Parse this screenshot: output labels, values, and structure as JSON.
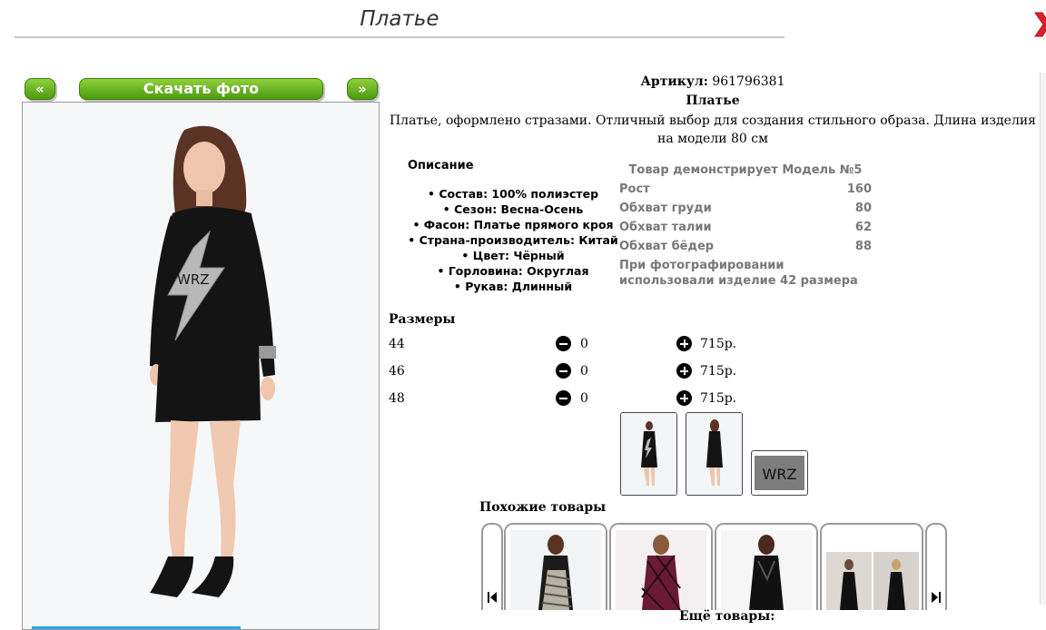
{
  "page_title": "Платье",
  "nav": {
    "prev": "«",
    "download": "Скачать фото",
    "next": "»"
  },
  "product": {
    "article_label": "Артикул:",
    "article": "961796381",
    "name": "Платье",
    "description": "Платье, оформлено стразами. Отличный выбор для создания стильного образа. Длина изделия на модели 80 см"
  },
  "details": {
    "title": "Описание",
    "items": [
      "Состав: 100% полиэстер",
      "Сезон: Весна-Осень",
      "Фасон: Платье прямого кроя",
      "Страна-производитель: Китай",
      "Цвет: Чёрный",
      "Горловина: Округлая",
      "Рукав: Длинный"
    ]
  },
  "model": {
    "title": "Товар демонстрирует Модель №5",
    "rows": [
      {
        "label": "Рост",
        "value": "160"
      },
      {
        "label": "Обхват груди",
        "value": "80"
      },
      {
        "label": "Обхват талии",
        "value": "62"
      },
      {
        "label": "Обхват бёдер",
        "value": "88"
      }
    ],
    "note": "При фотографировании использовали изделие 42 размера"
  },
  "sizes": {
    "title": "Размеры",
    "rows": [
      {
        "size": "44",
        "qty": "0",
        "price": "715р."
      },
      {
        "size": "46",
        "qty": "0",
        "price": "715р."
      },
      {
        "size": "48",
        "qty": "0",
        "price": "715р."
      }
    ]
  },
  "thumbnail_print_text": "WRZ",
  "similar_title": "Похожие товары",
  "more_title": "Ещё товары:",
  "colors": {
    "button_green": "#5aa818",
    "close_red": "#e0202a",
    "dress": "#111111"
  }
}
